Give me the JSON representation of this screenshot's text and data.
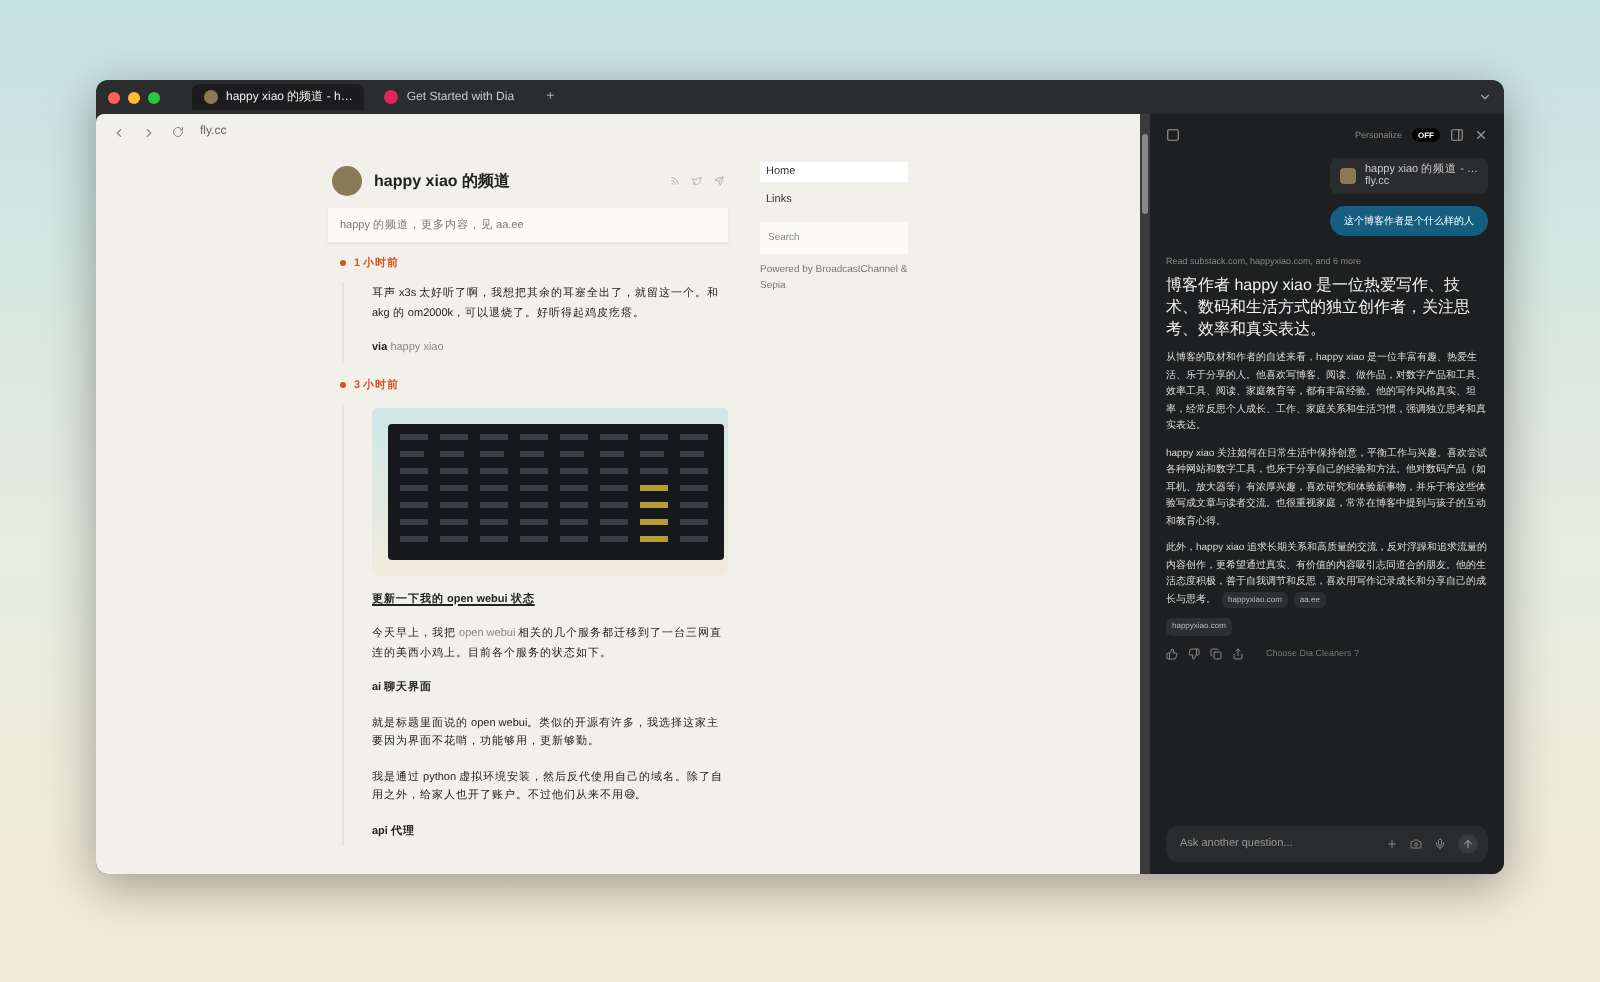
{
  "browser": {
    "tabs": [
      {
        "title": "happy xiao 的频道 - h…",
        "selected": true
      },
      {
        "title": "Get Started with Dia",
        "selected": false
      }
    ],
    "new_tab": "+",
    "address": "fly.cc"
  },
  "channel": {
    "title": "happy xiao 的频道",
    "description": "happy 的频道，更多内容，见 aa.ee",
    "posts": [
      {
        "time": "1 小时前",
        "blocks": [
          {
            "kind": "p",
            "parts": [
              {
                "kind": "text",
                "text": "耳声 x3s 太好听了啊，我想把其余的耳塞全出了，就留这一个。和 akg 的 om2000k，可以退烧了。好听得起鸡皮疙瘩。"
              }
            ]
          },
          {
            "kind": "p",
            "parts": [
              {
                "kind": "bold",
                "text": "via "
              },
              {
                "kind": "link",
                "text": "happy xiao"
              }
            ]
          }
        ]
      },
      {
        "time": "3 小时前",
        "blocks": [
          {
            "kind": "image"
          },
          {
            "kind": "heading",
            "parts": [
              {
                "kind": "text",
                "text": "更新一下我的 open webui 状态"
              }
            ]
          },
          {
            "kind": "p",
            "parts": [
              {
                "kind": "text",
                "text": "今天早上，我把 "
              },
              {
                "kind": "link",
                "text": "open webui"
              },
              {
                "kind": "text",
                "text": " 相关的几个服务都迁移到了一台三网直连的美西小鸡上。目前各个服务的状态如下。"
              }
            ]
          },
          {
            "kind": "subheading",
            "parts": [
              {
                "kind": "text",
                "text": "ai 聊天界面"
              }
            ]
          },
          {
            "kind": "p",
            "parts": [
              {
                "kind": "text",
                "text": "就是标题里面说的 open webui。类似的开源有许多，我选择这家主要因为界面不花哨，功能够用，更新够勤。"
              }
            ]
          },
          {
            "kind": "p",
            "parts": [
              {
                "kind": "text",
                "text": "我是通过 python 虚拟环境安装，然后反代使用自己的域名。除了自用之外，给家人也开了账户。不过他们从来不用😅。"
              }
            ]
          },
          {
            "kind": "subheading",
            "parts": [
              {
                "kind": "text",
                "text": "api 代理"
              }
            ]
          }
        ]
      }
    ]
  },
  "sidebar": {
    "items": [
      {
        "label": "Home",
        "selected": true
      },
      {
        "label": "Links",
        "selected": false
      }
    ],
    "search": {
      "placeholder": "Search"
    },
    "powered_by": "Powered by BroadcastChannel & Sepia"
  },
  "assistant": {
    "personalize": {
      "label": "Personalize",
      "state": "OFF"
    },
    "context_card": {
      "title": "happy xiao 的频道 - …",
      "site": "fly.cc"
    },
    "question": "这个博客作者是个什么样的人",
    "sources_read": "Read substack.com, happyxiao.com, and 6 more",
    "answer_heading": "博客作者 happy xiao 是一位热爱写作、技术、数码和生活方式的独立创作者，关注思考、效率和真实表达。",
    "answer_paragraphs": [
      {
        "text": "从博客的取材和作者的自述来看，happy xiao 是一位丰富有趣、热爱生活、乐于分享的人。他喜欢写博客、阅读、做作品，对数字产品和工具、效率工具、阅读、家庭教育等，都有丰富经验。他的写作风格真实、坦率，经常反思个人成长、工作、家庭关系和生活习惯，强调独立思考和真实表达。"
      },
      {
        "text": "happy xiao 关注如何在日常生活中保持创意，平衡工作与兴趣。喜欢尝试各种网站和数字工具，也乐于分享自己的经验和方法。他对数码产品（如耳机、放大器等）有浓厚兴趣，喜欢研究和体验新事物，并乐于将这些体验写成文章与读者交流。也很重视家庭，常常在博客中提到与孩子的互动和教育心得。"
      },
      {
        "text": "此外，happy xiao 追求长期关系和高质量的交流，反对浮躁和追求流量的内容创作，更希望通过真实、有价值的内容吸引志同道合的朋友。他的生活态度积极，善于自我调节和反思，喜欢用写作记录成长和分享自己的成长与思考。",
        "sources": [
          "happyxiao.com",
          "aa.ee"
        ]
      }
    ],
    "extra_source": "happyxiao.com",
    "skills_link": "Choose Dia Cleaners ?",
    "input": {
      "placeholder": "Ask another question..."
    }
  }
}
